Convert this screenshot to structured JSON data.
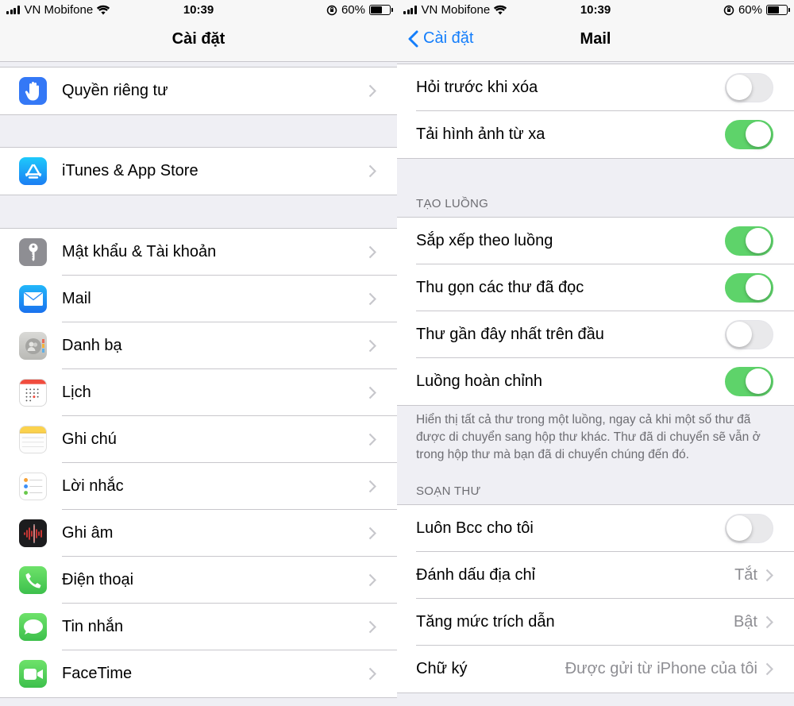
{
  "status": {
    "carrier": "VN Mobifone",
    "time": "10:39",
    "battery": "60%",
    "battery_level": 0.6
  },
  "left": {
    "title": "Cài đặt",
    "items": [
      {
        "label": "Quyền riêng tư",
        "icon": "privacy-hand-icon"
      },
      {
        "label": "iTunes & App Store",
        "icon": "app-store-icon"
      },
      {
        "label": "Mật khẩu & Tài khoản",
        "icon": "key-icon"
      },
      {
        "label": "Mail",
        "icon": "mail-icon"
      },
      {
        "label": "Danh bạ",
        "icon": "contacts-icon"
      },
      {
        "label": "Lịch",
        "icon": "calendar-icon"
      },
      {
        "label": "Ghi chú",
        "icon": "notes-icon"
      },
      {
        "label": "Lời nhắc",
        "icon": "reminders-icon"
      },
      {
        "label": "Ghi âm",
        "icon": "voice-memos-icon"
      },
      {
        "label": "Điện thoại",
        "icon": "phone-icon"
      },
      {
        "label": "Tin nhắn",
        "icon": "messages-icon"
      },
      {
        "label": "FaceTime",
        "icon": "facetime-icon"
      }
    ]
  },
  "right": {
    "back_label": "Cài đặt",
    "title": "Mail",
    "group1": [
      {
        "label": "Hỏi trước khi xóa",
        "on": false
      },
      {
        "label": "Tải hình ảnh từ xa",
        "on": true
      }
    ],
    "threading_header": "TẠO LUỒNG",
    "threading": [
      {
        "label": "Sắp xếp theo luồng",
        "on": true
      },
      {
        "label": "Thu gọn các thư đã đọc",
        "on": true
      },
      {
        "label": "Thư gần đây nhất trên đầu",
        "on": false
      },
      {
        "label": "Luồng hoàn chỉnh",
        "on": true
      }
    ],
    "threading_footer": "Hiển thị tất cả thư trong một luồng, ngay cả khi một số thư đã được di chuyển sang hộp thư khác. Thư đã di chuyển sẽ vẫn ở trong hộp thư mà bạn đã di chuyển chúng đến đó.",
    "compose_header": "SOẠN THƯ",
    "compose": {
      "bcc_label": "Luôn Bcc cho tôi",
      "bcc_on": false,
      "mark_label": "Đánh dấu địa chỉ",
      "mark_value": "Tắt",
      "quote_label": "Tăng mức trích dẫn",
      "quote_value": "Bật",
      "sig_label": "Chữ ký",
      "sig_value": "Được gửi từ iPhone của tôi"
    }
  },
  "colors": {
    "accent": "#147efb",
    "toggle_on": "#5ed36a",
    "background": "#efeff4"
  }
}
